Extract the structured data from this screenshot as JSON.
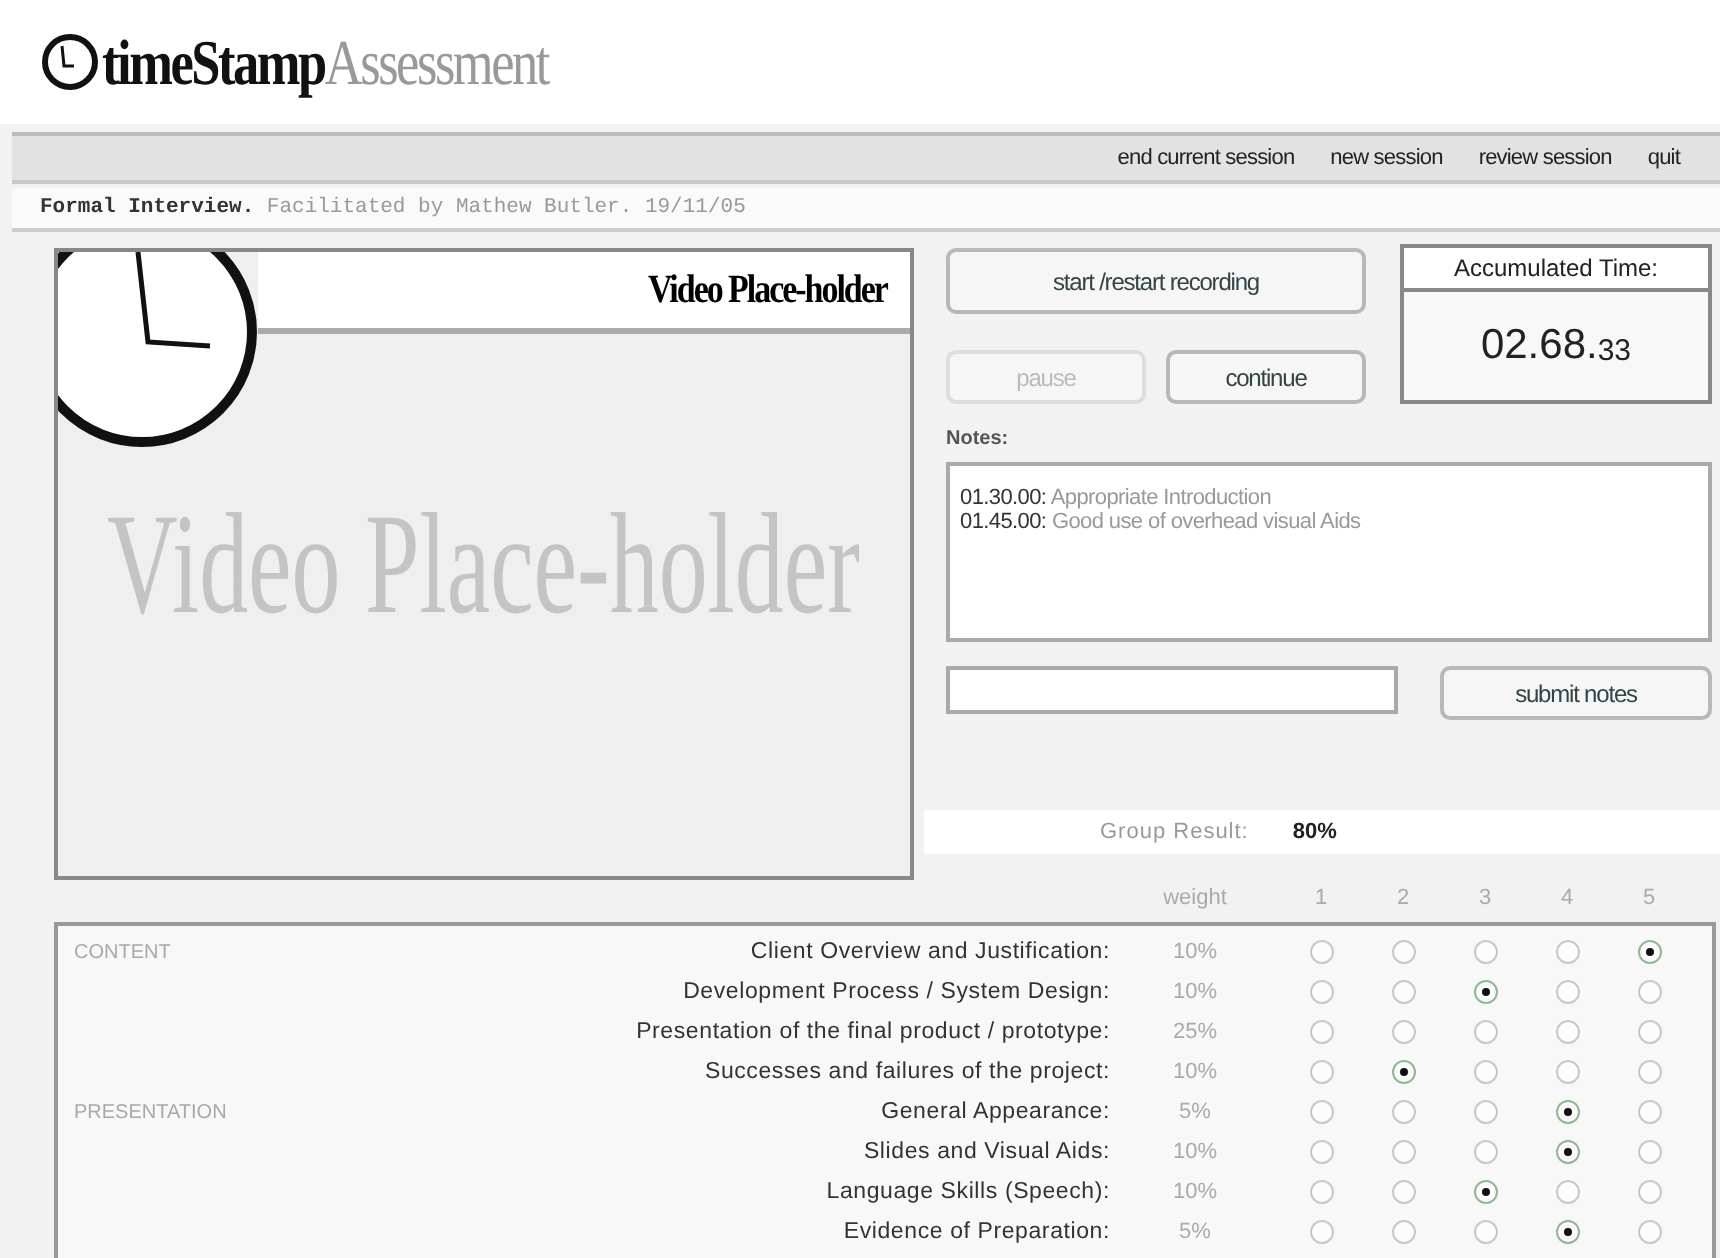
{
  "logo": {
    "text": "**timeStamp**Assessment"
  },
  "menu": [
    "end current session",
    "new session",
    "review session",
    "quit"
  ],
  "session": "**Formal Interview.** Facilitated by Mathew Butler. 19/11/05",
  "video": {
    "title": "Video Place-holder",
    "watermark": "Video Place-holder"
  },
  "buttons": {
    "record": {
      "label": "start /restart recording",
      "disabled": false
    },
    "pause": {
      "label": "pause",
      "disabled": true
    },
    "continue": {
      "label": "continue",
      "disabled": false
    },
    "submit": {
      "label": "submit notes",
      "disabled": false
    }
  },
  "timer": {
    "label": "Accumulated Time:",
    "main": "02.68.",
    "fraction": "33"
  },
  "notes": {
    "label": "Notes:",
    "entries": [
      {
        "time": "01.30.00:",
        "text": "Appropriate Introduction"
      },
      {
        "time": "01.45.00:",
        "text": "Good use of overhead visual Aids"
      }
    ]
  },
  "group_result": {
    "label": "Group Result:",
    "value": "80%"
  },
  "table": {
    "weight_heading": "weight",
    "scale": [
      "1",
      "2",
      "3",
      "4",
      "5"
    ],
    "groups": [
      {
        "name": "CONTENT",
        "criteria": [
          {
            "label": "Client Overview and Justification:",
            "weight": "10%",
            "ratings": [
              {
                "selected": false
              },
              {
                "selected": false
              },
              {
                "selected": false
              },
              {
                "selected": false
              },
              {
                "selected": true
              }
            ]
          },
          {
            "label": "Development Process / System Design:",
            "weight": "10%",
            "ratings": [
              {
                "selected": false
              },
              {
                "selected": false
              },
              {
                "selected": true
              },
              {
                "selected": false
              },
              {
                "selected": false
              }
            ]
          },
          {
            "label": "Presentation of the final product / prototype:",
            "weight": "25%",
            "ratings": [
              {
                "selected": false
              },
              {
                "selected": false
              },
              {
                "selected": false
              },
              {
                "selected": false
              },
              {
                "selected": false
              }
            ]
          },
          {
            "label": "Successes and failures of the project:",
            "weight": "10%",
            "ratings": [
              {
                "selected": false
              },
              {
                "selected": true
              },
              {
                "selected": false
              },
              {
                "selected": false
              },
              {
                "selected": false
              }
            ]
          }
        ]
      },
      {
        "name": "PRESENTATION",
        "criteria": [
          {
            "label": "General Appearance:",
            "weight": "5%",
            "ratings": [
              {
                "selected": false
              },
              {
                "selected": false
              },
              {
                "selected": false
              },
              {
                "selected": true
              },
              {
                "selected": false
              }
            ]
          },
          {
            "label": "Slides and Visual Aids:",
            "weight": "10%",
            "ratings": [
              {
                "selected": false
              },
              {
                "selected": false
              },
              {
                "selected": false
              },
              {
                "selected": true
              },
              {
                "selected": false
              }
            ]
          },
          {
            "label": "Language Skills (Speech):",
            "weight": "10%",
            "ratings": [
              {
                "selected": false
              },
              {
                "selected": false
              },
              {
                "selected": true
              },
              {
                "selected": false
              },
              {
                "selected": false
              }
            ]
          },
          {
            "label": "Evidence of Preparation:",
            "weight": "5%",
            "ratings": [
              {
                "selected": false
              },
              {
                "selected": false
              },
              {
                "selected": false
              },
              {
                "selected": true
              },
              {
                "selected": false
              }
            ]
          }
        ]
      }
    ]
  }
}
